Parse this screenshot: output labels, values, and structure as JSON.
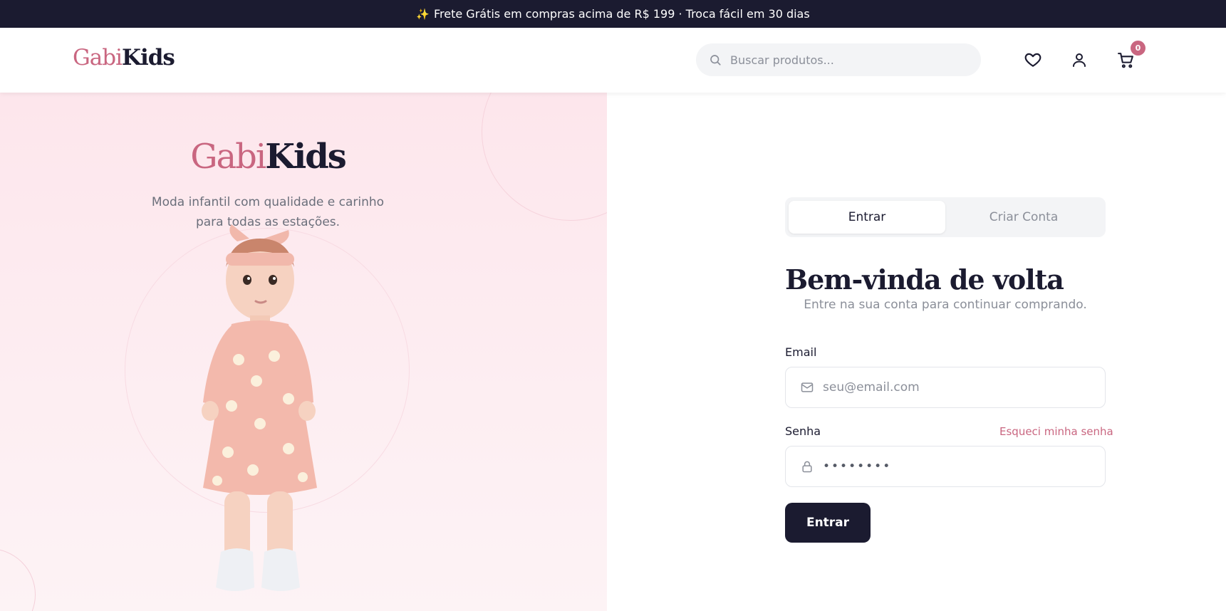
{
  "announcement": {
    "icon": "sparkle-icon",
    "text": "Frete Grátis em compras acima de R$ 199 · Troca fácil em 30 dias"
  },
  "header": {
    "logo": {
      "part1": "Gabi",
      "part2": "Kids"
    },
    "search": {
      "placeholder": "Buscar produtos...",
      "value": ""
    },
    "icons": [
      "heart-icon",
      "user-icon",
      "cart-icon"
    ],
    "cart_count": "0"
  },
  "hero": {
    "logo": {
      "part1": "Gabi",
      "part2": "Kids"
    },
    "tagline_line1": "Moda infantil com qualidade e carinho",
    "tagline_line2": "para todas as estações."
  },
  "auth": {
    "tabs": [
      {
        "label": "Entrar",
        "active": true
      },
      {
        "label": "Criar Conta",
        "active": false
      }
    ],
    "title": "Bem-vinda de volta",
    "subtitle": "Entre na sua conta para continuar comprando.",
    "email": {
      "label": "Email",
      "placeholder": "seu@email.com",
      "value": ""
    },
    "password": {
      "label": "Senha",
      "forgot": "Esqueci minha senha",
      "value": "••••••••"
    },
    "submit": "Entrar"
  },
  "colors": {
    "brand_pink": "#c96680",
    "dark_navy": "#1b1b30",
    "hero_bg": "#fde6ec"
  }
}
